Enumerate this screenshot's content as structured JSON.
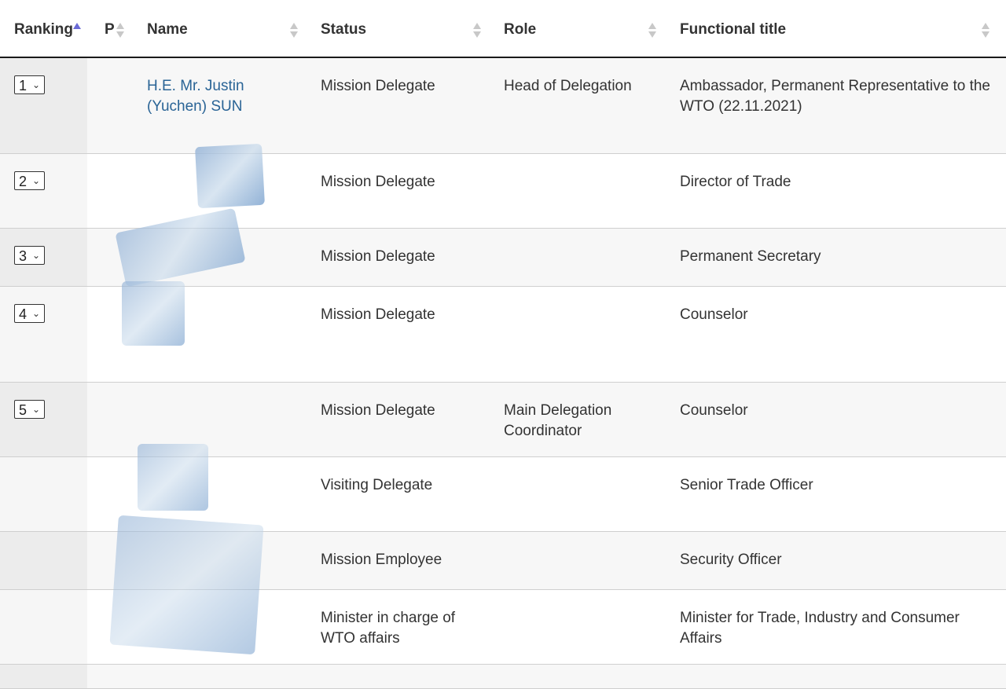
{
  "headers": {
    "ranking": "Ranking",
    "p": "P",
    "name": "Name",
    "status": "Status",
    "role": "Role",
    "functional_title": "Functional title"
  },
  "rows": [
    {
      "rank": "1",
      "name": "H.E. Mr. Justin (Yuchen) SUN",
      "status": "Mission Delegate",
      "role": "Head of Delegation",
      "title": "Ambassador, Permanent Representative to the WTO (22.11.2021)"
    },
    {
      "rank": "2",
      "name": "",
      "status": "Mission Delegate",
      "role": "",
      "title": "Director of Trade"
    },
    {
      "rank": "3",
      "name": "",
      "status": "Mission Delegate",
      "role": "",
      "title": "Permanent Secretary"
    },
    {
      "rank": "4",
      "name": "",
      "status": "Mission Delegate",
      "role": "",
      "title": "Counselor"
    },
    {
      "rank": "5",
      "name": "",
      "status": "Mission Delegate",
      "role": "Main Delegation Coordinator",
      "title": "Counselor"
    },
    {
      "rank": "",
      "name": "",
      "status": "Visiting Delegate",
      "role": "",
      "title": "Senior Trade Officer"
    },
    {
      "rank": "",
      "name": "",
      "status": "Mission Employee",
      "role": "",
      "title": "Security Officer"
    },
    {
      "rank": "",
      "name": "",
      "status": "Minister in charge of WTO affairs",
      "role": "",
      "title": "Minister for Trade, Industry and Consumer Affairs"
    }
  ],
  "colors": {
    "link": "#2a6496",
    "sort_active": "#6b6bd6"
  },
  "icons": {
    "sort": "sort-arrows-icon",
    "dropdown": "chevron-down-icon"
  }
}
